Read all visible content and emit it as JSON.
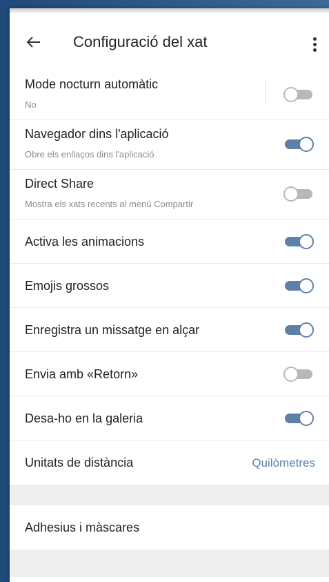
{
  "app": {
    "title": "Configuració del xat",
    "accent": "#5e7fa8"
  },
  "settings": [
    {
      "label": "Mode nocturn automàtic",
      "sub": "No",
      "state": "off"
    },
    {
      "label": "Navegador dins l'aplicació",
      "sub": "Obre els enllaços dins l'aplicació",
      "state": "on"
    },
    {
      "label": "Direct Share",
      "sub": "Mostra els xats recents al menú Compartir",
      "state": "off"
    },
    {
      "label": "Activa les animacions",
      "state": "on"
    },
    {
      "label": "Emojis grossos",
      "state": "on"
    },
    {
      "label": "Enregistra un missatge en alçar",
      "state": "on"
    },
    {
      "label": "Envia amb «Retorn»",
      "state": "off"
    },
    {
      "label": "Desa-ho en la galeria",
      "state": "on"
    },
    {
      "label": "Unitats de distància",
      "value": "Quilòmetres"
    }
  ],
  "section2": {
    "label": "Adhesius i màscares"
  }
}
